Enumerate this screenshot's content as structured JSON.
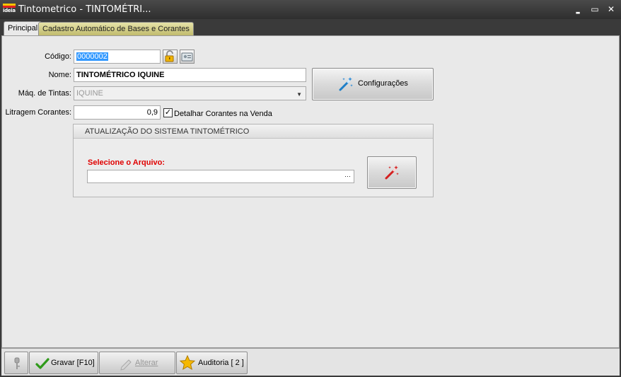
{
  "window": {
    "title": "Tintometrico - TINTOMÉTRI...",
    "logo_text": "ideia",
    "minimize_glyph": "▬",
    "maximize_glyph": "▭",
    "close_glyph": "✕"
  },
  "tabs": [
    {
      "label": "Principal",
      "active": true
    },
    {
      "label": "Cadastro Automático de Bases e Corantes",
      "active": false
    }
  ],
  "form": {
    "codigo_label": "Código:",
    "codigo_value": "0000002",
    "nome_label": "Nome:",
    "nome_value": "TINTOMÉTRICO IQUINE",
    "maq_label": "Máq. de Tintas:",
    "maq_value": "IQUINE",
    "litragem_label": "Litragem Corantes:",
    "litragem_value": "0,9",
    "detalhar_label": "Detalhar Corantes na Venda",
    "detalhar_checked": true,
    "configuracoes_label": "Configurações"
  },
  "atualizacao": {
    "title": "ATUALIZAÇÃO DO SISTEMA TINTOMÉTRICO",
    "arquivo_label": "Selecione o Arquivo:",
    "arquivo_value": "",
    "ellipsis": "···"
  },
  "footer": {
    "gravar_label": "Gravar [F10]",
    "alterar_label": "Alterar",
    "auditoria_label": "Auditoria [ 2 ]"
  },
  "colors": {
    "required_label": "#e00000",
    "selection": "#3399ff",
    "titlebar": "#3a3a3a"
  },
  "icons": {
    "logo": "app-logo-icon",
    "unlock": "unlock-icon",
    "card": "id-card-icon",
    "magic_wand": "magic-wand-icon",
    "key": "key-icon",
    "check": "check-icon",
    "pencil": "pencil-icon",
    "star": "star-icon"
  }
}
